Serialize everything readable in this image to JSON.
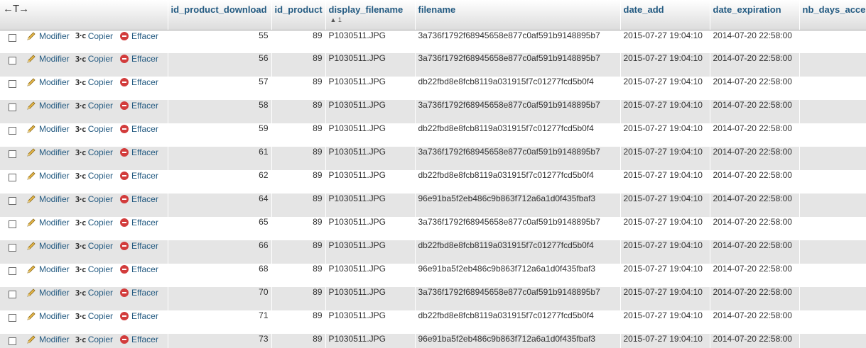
{
  "table": {
    "nav_arrows": "←T→",
    "columns": [
      {
        "label": "id_product_download",
        "sort": ""
      },
      {
        "label": "id_product",
        "sort": ""
      },
      {
        "label": "display_filename",
        "sort": "▲ 1"
      },
      {
        "label": "filename",
        "sort": ""
      },
      {
        "label": "date_add",
        "sort": ""
      },
      {
        "label": "date_expiration",
        "sort": ""
      },
      {
        "label": "nb_days_accessible",
        "sort": ""
      }
    ],
    "actions": {
      "edit": "Modifier",
      "copy": "Copier",
      "delete": "Effacer"
    },
    "rows": [
      {
        "id": "55",
        "product": "89",
        "display": "P1030511.JPG",
        "filename": "3a736f1792f68945658e877c0af591b9148895b7",
        "date_add": "2015-07-27 19:04:10",
        "date_exp": "2014-07-20 22:58:00"
      },
      {
        "id": "56",
        "product": "89",
        "display": "P1030511.JPG",
        "filename": "3a736f1792f68945658e877c0af591b9148895b7",
        "date_add": "2015-07-27 19:04:10",
        "date_exp": "2014-07-20 22:58:00"
      },
      {
        "id": "57",
        "product": "89",
        "display": "P1030511.JPG",
        "filename": "db22fbd8e8fcb8119a031915f7c01277fcd5b0f4",
        "date_add": "2015-07-27 19:04:10",
        "date_exp": "2014-07-20 22:58:00"
      },
      {
        "id": "58",
        "product": "89",
        "display": "P1030511.JPG",
        "filename": "3a736f1792f68945658e877c0af591b9148895b7",
        "date_add": "2015-07-27 19:04:10",
        "date_exp": "2014-07-20 22:58:00"
      },
      {
        "id": "59",
        "product": "89",
        "display": "P1030511.JPG",
        "filename": "db22fbd8e8fcb8119a031915f7c01277fcd5b0f4",
        "date_add": "2015-07-27 19:04:10",
        "date_exp": "2014-07-20 22:58:00"
      },
      {
        "id": "61",
        "product": "89",
        "display": "P1030511.JPG",
        "filename": "3a736f1792f68945658e877c0af591b9148895b7",
        "date_add": "2015-07-27 19:04:10",
        "date_exp": "2014-07-20 22:58:00"
      },
      {
        "id": "62",
        "product": "89",
        "display": "P1030511.JPG",
        "filename": "db22fbd8e8fcb8119a031915f7c01277fcd5b0f4",
        "date_add": "2015-07-27 19:04:10",
        "date_exp": "2014-07-20 22:58:00"
      },
      {
        "id": "64",
        "product": "89",
        "display": "P1030511.JPG",
        "filename": "96e91ba5f2eb486c9b863f712a6a1d0f435fbaf3",
        "date_add": "2015-07-27 19:04:10",
        "date_exp": "2014-07-20 22:58:00"
      },
      {
        "id": "65",
        "product": "89",
        "display": "P1030511.JPG",
        "filename": "3a736f1792f68945658e877c0af591b9148895b7",
        "date_add": "2015-07-27 19:04:10",
        "date_exp": "2014-07-20 22:58:00"
      },
      {
        "id": "66",
        "product": "89",
        "display": "P1030511.JPG",
        "filename": "db22fbd8e8fcb8119a031915f7c01277fcd5b0f4",
        "date_add": "2015-07-27 19:04:10",
        "date_exp": "2014-07-20 22:58:00"
      },
      {
        "id": "68",
        "product": "89",
        "display": "P1030511.JPG",
        "filename": "96e91ba5f2eb486c9b863f712a6a1d0f435fbaf3",
        "date_add": "2015-07-27 19:04:10",
        "date_exp": "2014-07-20 22:58:00"
      },
      {
        "id": "70",
        "product": "89",
        "display": "P1030511.JPG",
        "filename": "3a736f1792f68945658e877c0af591b9148895b7",
        "date_add": "2015-07-27 19:04:10",
        "date_exp": "2014-07-20 22:58:00"
      },
      {
        "id": "71",
        "product": "89",
        "display": "P1030511.JPG",
        "filename": "db22fbd8e8fcb8119a031915f7c01277fcd5b0f4",
        "date_add": "2015-07-27 19:04:10",
        "date_exp": "2014-07-20 22:58:00"
      },
      {
        "id": "73",
        "product": "89",
        "display": "P1030511.JPG",
        "filename": "96e91ba5f2eb486c9b863f712a6a1d0f435fbaf3",
        "date_add": "2015-07-27 19:04:10",
        "date_exp": "2014-07-20 22:58:00"
      }
    ]
  },
  "colors": {
    "link": "#235a81",
    "row_even": "#e5e5e5",
    "header_bg": "#dcdcdc",
    "delete_icon": "#d23c3c"
  }
}
